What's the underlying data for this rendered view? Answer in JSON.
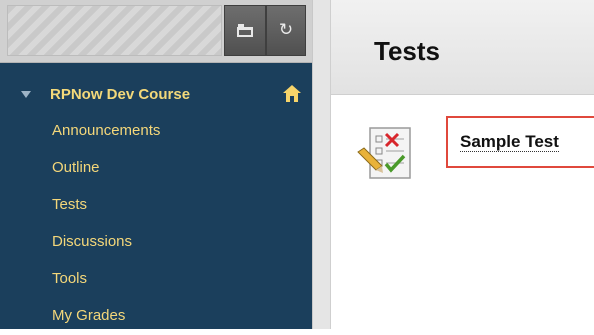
{
  "course": {
    "name": "RPNow Dev Course"
  },
  "nav": {
    "items": [
      {
        "label": "Announcements"
      },
      {
        "label": "Outline"
      },
      {
        "label": "Tests"
      },
      {
        "label": "Discussions"
      },
      {
        "label": "Tools"
      },
      {
        "label": "My Grades"
      }
    ]
  },
  "page": {
    "title": "Tests"
  },
  "content": {
    "item_label": "Sample Test"
  },
  "icons": {
    "toolbar_folder": "folder-icon",
    "toolbar_refresh": "refresh-icon",
    "home": "home-icon",
    "test_item": "test-document-icon"
  },
  "colors": {
    "sidebar_bg": "#1b3f5c",
    "nav_text": "#f4d77a",
    "highlight_border": "#e0483c"
  }
}
